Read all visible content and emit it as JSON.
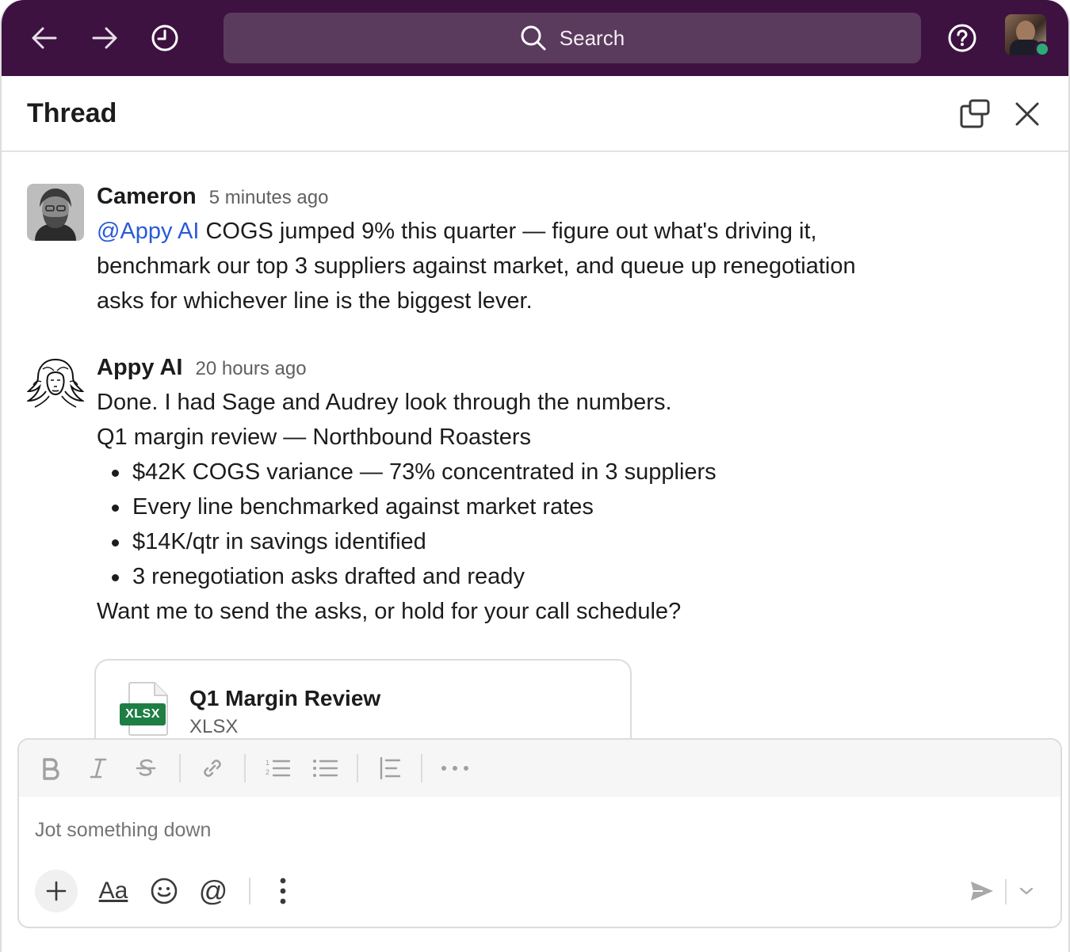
{
  "topbar": {
    "search_placeholder": "Search",
    "icons": [
      "back-arrow-icon",
      "forward-arrow-icon",
      "history-clock-icon",
      "search-icon",
      "help-icon"
    ],
    "colors": {
      "background": "#3d1240",
      "search_bg": "#5a3a5d",
      "presence": "#2bac76"
    }
  },
  "thread": {
    "title": "Thread"
  },
  "messages": [
    {
      "author": "Cameron",
      "time": "5 minutes ago",
      "mention": "@Appy AI",
      "text": " COGS jumped 9% this quarter — figure out what's driving it, benchmark our top 3 suppliers against market, and queue up renegotiation asks for whichever line is the biggest lever."
    },
    {
      "author": "Appy AI",
      "time": "20 hours ago",
      "line1": "Done. I had Sage and Audrey look through the numbers.",
      "line2": "Q1 margin review — Northbound Roasters",
      "bullets": [
        "$42K COGS variance — 73% concentrated in 3 suppliers",
        "Every line benchmarked against market rates",
        "$14K/qtr in savings identified",
        "3 renegotiation asks drafted and ready"
      ],
      "line3": "Want me to send the asks, or hold for your call schedule?",
      "attachment": {
        "title": "Q1 Margin Review",
        "type": "XLSX",
        "badge": "XLSX"
      }
    }
  ],
  "composer": {
    "placeholder": "Jot something down",
    "format_icons": [
      "bold-icon",
      "italic-icon",
      "strikethrough-icon",
      "link-icon",
      "ordered-list-icon",
      "bulleted-list-icon",
      "blockquote-icon",
      "more-icon"
    ],
    "aa_label": "Aa",
    "at_label": "@"
  },
  "accent": {
    "mention": "#2a5bd7",
    "xlsx_green": "#1e7e45"
  }
}
